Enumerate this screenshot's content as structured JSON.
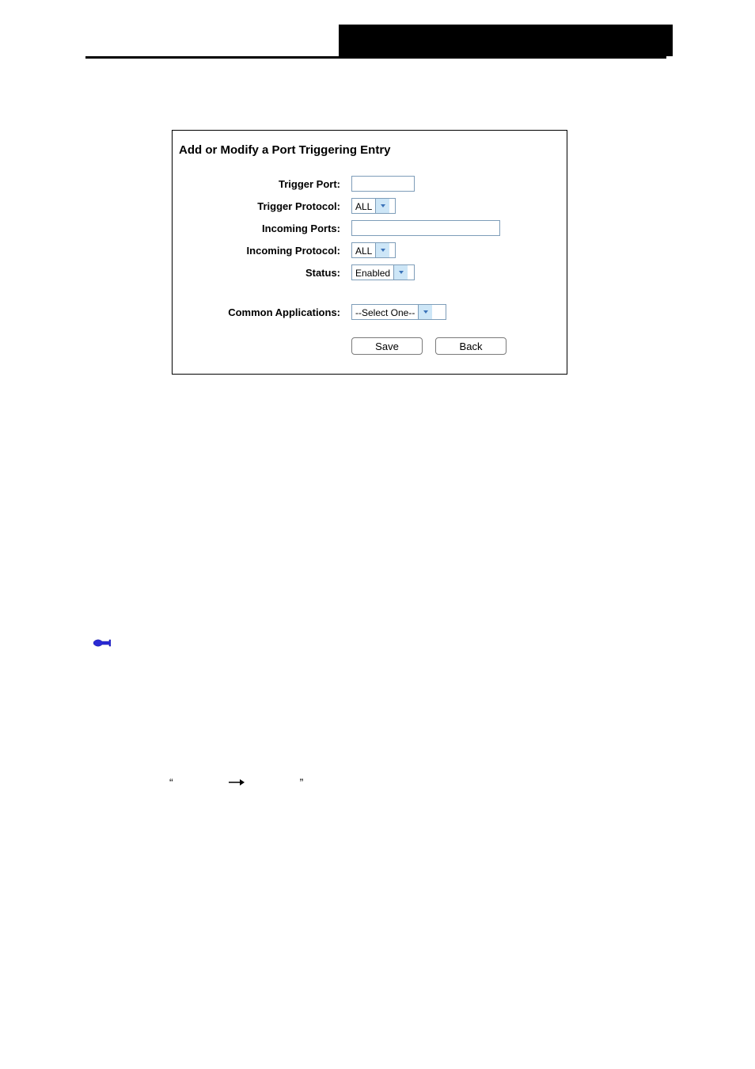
{
  "panel": {
    "title": "Add or Modify a Port Triggering Entry",
    "rows": {
      "trigger_port": {
        "label": "Trigger Port:"
      },
      "trigger_protocol": {
        "label": "Trigger Protocol:",
        "value": "ALL"
      },
      "incoming_ports": {
        "label": "Incoming Ports:"
      },
      "incoming_protocol": {
        "label": "Incoming Protocol:",
        "value": "ALL"
      },
      "status": {
        "label": "Status:",
        "value": "Enabled"
      },
      "common_applications": {
        "label": "Common Applications:",
        "value": "--Select One--"
      }
    },
    "buttons": {
      "save": "Save",
      "back": "Back"
    }
  },
  "quote_line": {
    "left_quote": "“",
    "right_quote": "”"
  }
}
